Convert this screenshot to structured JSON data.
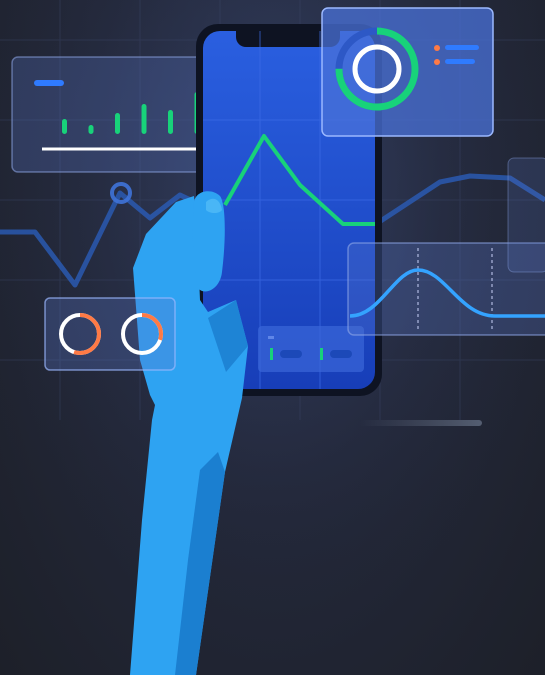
{
  "illustration": {
    "theme": "hand holding smartphone with floating analytics widgets",
    "colors": {
      "background": "#23283a",
      "grid": "#3a4566",
      "phone_body": "#101626",
      "phone_screen": "#1f56d6",
      "panel_fill": "#4a72d8",
      "panel_stroke": "#7fa4ff",
      "accent_green": "#18d27a",
      "accent_blue": "#2f7bff",
      "accent_orange": "#ff7a45",
      "hand_light": "#2ea3f2",
      "hand_dark": "#1b7fd0",
      "white": "#ffffff"
    },
    "icons": [
      "donut-chart-icon",
      "ring-progress-icon",
      "legend-dots-icon"
    ],
    "mini_bars": [
      0.25,
      0.15,
      0.35,
      0.5,
      0.4,
      0.7,
      0.2
    ],
    "ring_progress": [
      0.55,
      0.3,
      0.75
    ]
  }
}
